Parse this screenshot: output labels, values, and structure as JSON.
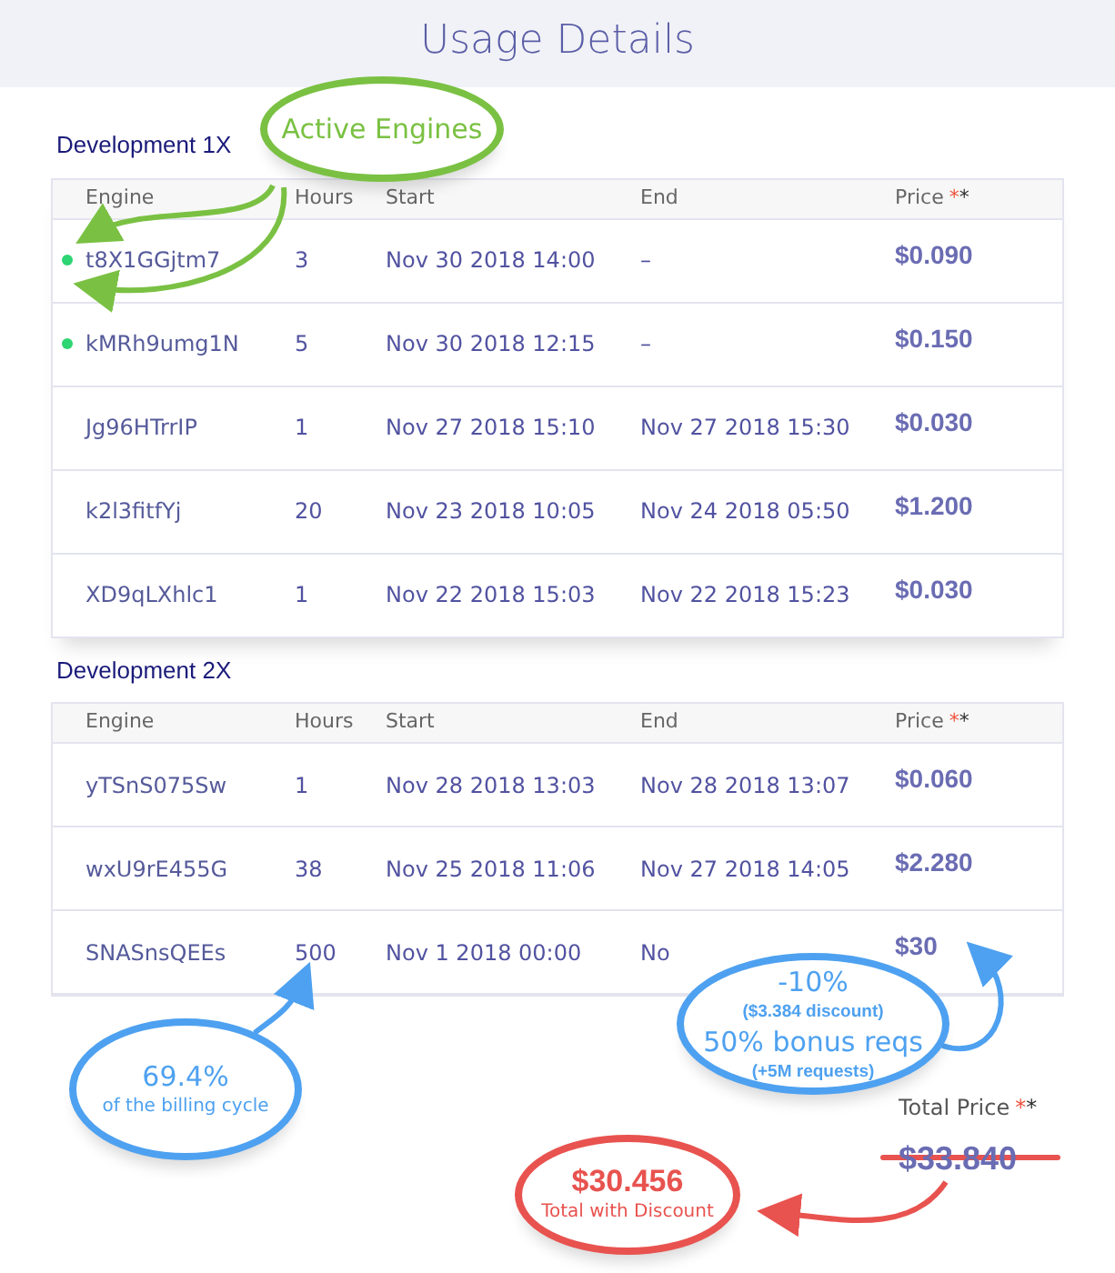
{
  "title": "Usage Details",
  "sections": [
    {
      "name": "Development 1X",
      "columns": [
        {
          "label": "Engine"
        },
        {
          "label": "Hours"
        },
        {
          "label": "Start"
        },
        {
          "label": "End"
        },
        {
          "label": "Price",
          "marks": [
            "*",
            "*"
          ]
        }
      ],
      "rows": [
        {
          "engine": "t8X1GGjtm7",
          "active": true,
          "hours": "3",
          "start": "Nov 30 2018 14:00",
          "end": "–",
          "price": "$0.090"
        },
        {
          "engine": "kMRh9umg1N",
          "active": true,
          "hours": "5",
          "start": "Nov 30 2018 12:15",
          "end": "–",
          "price": "$0.150"
        },
        {
          "engine": "Jg96HTrrIP",
          "active": false,
          "hours": "1",
          "start": "Nov 27 2018 15:10",
          "end": "Nov 27 2018 15:30",
          "price": "$0.030"
        },
        {
          "engine": "k2l3fitfYj",
          "active": false,
          "hours": "20",
          "start": "Nov 23 2018 10:05",
          "end": "Nov 24 2018 05:50",
          "price": "$1.200"
        },
        {
          "engine": "XD9qLXhlc1",
          "active": false,
          "hours": "1",
          "start": "Nov 22 2018 15:03",
          "end": "Nov 22 2018 15:23",
          "price": "$0.030"
        }
      ]
    },
    {
      "name": "Development 2X",
      "columns": [
        {
          "label": "Engine"
        },
        {
          "label": "Hours"
        },
        {
          "label": "Start"
        },
        {
          "label": "End"
        },
        {
          "label": "Price",
          "marks": [
            "*",
            "*"
          ]
        }
      ],
      "rows": [
        {
          "engine": "yTSnS075Sw",
          "active": false,
          "hours": "1",
          "start": "Nov 28 2018 13:03",
          "end": "Nov 28 2018 13:07",
          "price": "$0.060"
        },
        {
          "engine": "wxU9rE455G",
          "active": false,
          "hours": "38",
          "start": "Nov 25 2018 11:06",
          "end": "Nov 27 2018 14:05",
          "price": "$2.280"
        },
        {
          "engine": "SNASnsQEEs",
          "active": false,
          "hours": "500",
          "start": "Nov 1 2018 00:00",
          "end": "No",
          "price": "$30"
        }
      ]
    }
  ],
  "total": {
    "label": "Total Price",
    "marks": [
      "*",
      "*"
    ],
    "amount": "$33.840",
    "struck": true
  },
  "callouts": [
    {
      "color": "#7ac143",
      "lines": [
        {
          "text": "Active Engines",
          "kind": "big"
        }
      ]
    },
    {
      "color": "#4ea1f0",
      "lines": [
        {
          "text": "69.4%",
          "kind": "big"
        },
        {
          "text": "of the billing cycle",
          "kind": "small"
        }
      ]
    },
    {
      "color": "#4ea1f0",
      "lines": [
        {
          "text": "-10%",
          "kind": "big"
        },
        {
          "text": "($3.384 discount)",
          "kind": "bold"
        },
        {
          "text": "50% bonus reqs",
          "kind": "big"
        },
        {
          "text": "(+5M requests)",
          "kind": "bold"
        }
      ]
    },
    {
      "color": "#e8534f",
      "lines": [
        {
          "text": "$30.456",
          "kind": "bigbold"
        },
        {
          "text": "Total with Discount",
          "kind": "small"
        }
      ]
    }
  ]
}
